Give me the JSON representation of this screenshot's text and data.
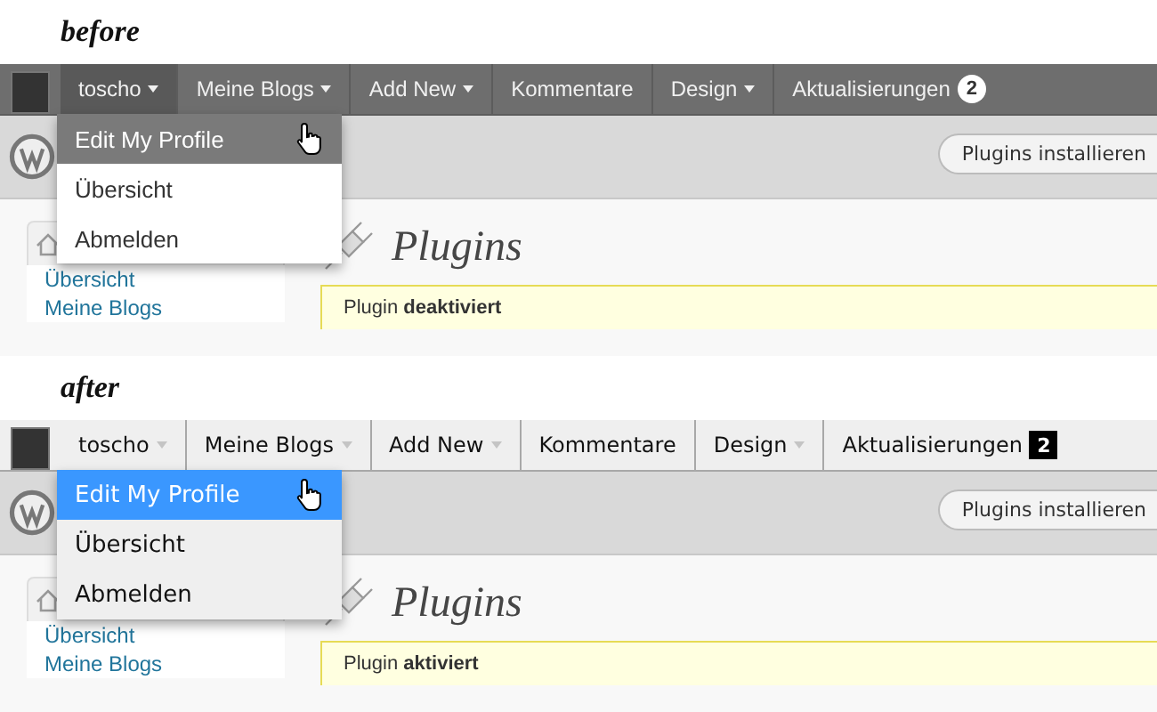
{
  "panels": [
    {
      "kind": "before",
      "caption": "before",
      "menu": [
        {
          "label": "toscho",
          "has_caret": true,
          "open": true
        },
        {
          "label": "Meine Blogs",
          "has_caret": true,
          "open": false
        },
        {
          "label": "Add New",
          "has_caret": true,
          "open": false
        },
        {
          "label": "Kommentare",
          "has_caret": false,
          "open": false
        },
        {
          "label": "Design",
          "has_caret": true,
          "open": false
        },
        {
          "label": "Aktualisierungen",
          "has_caret": false,
          "open": false,
          "badge": "2"
        }
      ],
      "dropdown": [
        {
          "label": "Edit My Profile",
          "selected": true
        },
        {
          "label": "Übersicht",
          "selected": false
        },
        {
          "label": "Abmelden",
          "selected": false
        }
      ],
      "header_button": "Plugins installieren",
      "sidebar_links": [
        "Übersicht",
        "Meine Blogs"
      ],
      "page_title": "Plugins",
      "notice": "Plugin **deaktiviert**"
    },
    {
      "kind": "after",
      "caption": "after",
      "menu": [
        {
          "label": "toscho",
          "has_caret": true
        },
        {
          "label": "Meine Blogs",
          "has_caret": true
        },
        {
          "label": "Add New",
          "has_caret": true
        },
        {
          "label": "Kommentare",
          "has_caret": false
        },
        {
          "label": "Design",
          "has_caret": true
        },
        {
          "label": "Aktualisierungen",
          "has_caret": false,
          "badge": "2"
        }
      ],
      "dropdown": [
        {
          "label": "Edit My Profile",
          "selected": true
        },
        {
          "label": "Übersicht",
          "selected": false
        },
        {
          "label": "Abmelden",
          "selected": false
        }
      ],
      "header_button": "Plugins installieren",
      "sidebar_links": [
        "Übersicht",
        "Meine Blogs"
      ],
      "page_title": "Plugins",
      "notice": "Plugin **aktiviert**"
    }
  ]
}
